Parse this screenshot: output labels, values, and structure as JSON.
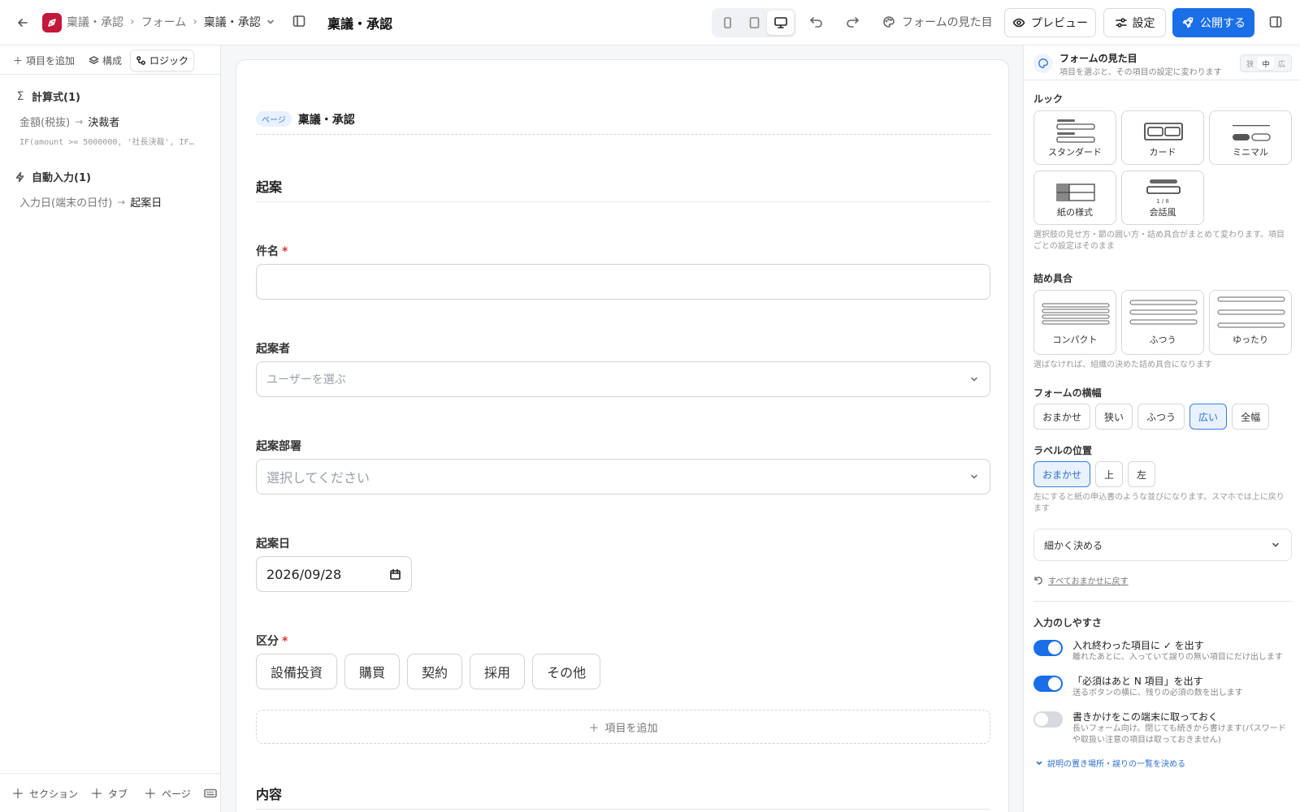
{
  "topbar": {
    "breadcrumb": [
      "稟議・承認",
      "フォーム",
      "稟議・承認"
    ],
    "title": "稟議・承認",
    "appearance_label": "フォームの見た目",
    "preview_label": "プレビュー",
    "settings_label": "設定",
    "publish_label": "公開する",
    "active_device": "desktop"
  },
  "left_panel": {
    "tabs": [
      {
        "label": "項目を追加",
        "active": false
      },
      {
        "label": "構成",
        "active": false
      },
      {
        "label": "ロジック",
        "active": true
      }
    ],
    "formula_section": {
      "title": "計算式(1)",
      "rule_source": "金額(税抜)",
      "rule_target": "決裁者",
      "formula": "IF(amount >= 5000000, '社長決裁', IF(a…"
    },
    "autofill_section": {
      "title": "自動入力(1)",
      "rule_source": "入力日(端末の日付)",
      "rule_target": "起案日"
    },
    "bottom_buttons": [
      "セクション",
      "タブ",
      "ページ"
    ]
  },
  "canvas": {
    "page_badge": "ページ",
    "page_name": "稟議・承認",
    "section1_title": "起案",
    "fields": {
      "subject": {
        "label": "件名",
        "required": "*"
      },
      "drafter": {
        "label": "起案者",
        "placeholder": "ユーザーを選ぶ"
      },
      "department": {
        "label": "起案部署",
        "placeholder": "選択してください"
      },
      "draft_date": {
        "label": "起案日",
        "value": "2026/09/28"
      },
      "category": {
        "label": "区分",
        "required": "*",
        "options": [
          "設備投資",
          "購買",
          "契約",
          "採用",
          "その他"
        ]
      }
    },
    "add_field_label": "項目を追加",
    "section2_title": "内容"
  },
  "right_panel": {
    "title": "フォームの見た目",
    "subtitle": "項目を選ぶと、その項目の設定に変わります",
    "size_options": [
      {
        "label": "狭",
        "active": false
      },
      {
        "label": "中",
        "active": true
      },
      {
        "label": "広",
        "active": false
      }
    ],
    "look": {
      "label": "ルック",
      "options": [
        "スタンダード",
        "カード",
        "ミニマル",
        "紙の様式",
        "会話風"
      ],
      "talk_counter": "1 / 8",
      "note": "選択肢の見せ方・節の囲い方・詰め具合がまとめて変わります。項目ごとの設定はそのまま"
    },
    "density": {
      "label": "詰め具合",
      "options": [
        "コンパクト",
        "ふつう",
        "ゆったり"
      ],
      "note": "選ばなければ、組織の決めた詰め具合になります"
    },
    "form_width": {
      "label": "フォームの横幅",
      "options": [
        {
          "label": "おまかせ",
          "active": false
        },
        {
          "label": "狭い",
          "active": false
        },
        {
          "label": "ふつう",
          "active": false
        },
        {
          "label": "広い",
          "active": true
        },
        {
          "label": "全幅",
          "active": false
        }
      ]
    },
    "label_position": {
      "label": "ラベルの位置",
      "options": [
        {
          "label": "おまかせ",
          "active": true
        },
        {
          "label": "上",
          "active": false
        },
        {
          "label": "左",
          "active": false
        }
      ],
      "note": "左にすると紙の申込書のような並びになります。スマホでは上に戻ります"
    },
    "detail_select_label": "細かく決める",
    "reset_label": "すべておまかせに戻す",
    "ease": {
      "label": "入力のしやすさ",
      "toggles": [
        {
          "title": "入れ終わった項目に ✓ を出す",
          "desc": "離れたあとに、入っていて誤りの無い項目にだけ出します",
          "on": true
        },
        {
          "title": "「必須はあと N 項目」を出す",
          "desc": "送るボタンの横に、残りの必須の数を出します",
          "on": true
        },
        {
          "title": "書きかけをこの端末に取っておく",
          "desc": "長いフォーム向け。閉じても続きから書けます(パスワードや取扱い注意の項目は取っておきません)",
          "on": false
        }
      ]
    },
    "more_link": "説明の置き場所・誤りの一覧を決める"
  },
  "colors": {
    "accent": "#1a6fe8",
    "brand": "#c3173b",
    "required": "#d33333",
    "selected_bg": "#e8f1fd"
  }
}
